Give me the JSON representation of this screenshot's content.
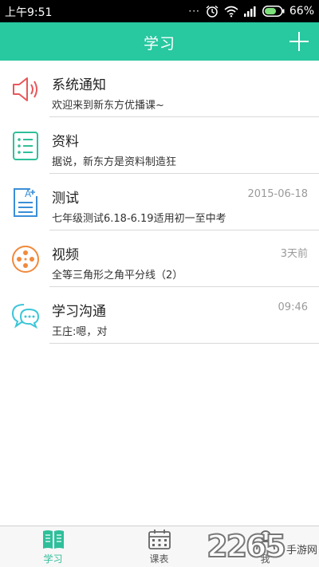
{
  "status_bar": {
    "time": "上午9:51",
    "battery": "66%",
    "icons": [
      "dots-icon",
      "alarm-icon",
      "wifi-icon",
      "signal-icon",
      "battery-icon"
    ]
  },
  "header": {
    "title": "学习",
    "add_icon": "plus-icon"
  },
  "list": [
    {
      "name": "系统通知",
      "subtitle": "欢迎来到新东方优播课~",
      "time": "",
      "icon": "speaker-icon",
      "icon_color": "#e8575a"
    },
    {
      "name": "资料",
      "subtitle": "据说，新东方是资料制造狂",
      "time": "",
      "icon": "list-doc-icon",
      "icon_color": "#2fbf9a"
    },
    {
      "name": "测试",
      "subtitle": "七年级测试6.18-6.19适用初一至中考",
      "time": "2015-06-18",
      "icon": "test-doc-icon",
      "icon_color": "#3a8fd8"
    },
    {
      "name": "视频",
      "subtitle": "全等三角形之角平分线（2）",
      "time": "3天前",
      "icon": "film-reel-icon",
      "icon_color": "#f08a3c"
    },
    {
      "name": "学习沟通",
      "subtitle": "王庄:嗯，对",
      "time": "09:46",
      "icon": "chat-bubbles-icon",
      "icon_color": "#3cc6d8"
    }
  ],
  "bottom_nav": [
    {
      "label": "学习",
      "icon": "book-icon",
      "active": true
    },
    {
      "label": "课表",
      "icon": "calendar-icon",
      "active": false
    },
    {
      "label": "我",
      "icon": "person-icon",
      "active": false
    }
  ],
  "watermark": {
    "number": "2265",
    "text": "手游网"
  },
  "colors": {
    "accent": "#28c8a0",
    "status_bar": "#000000"
  }
}
